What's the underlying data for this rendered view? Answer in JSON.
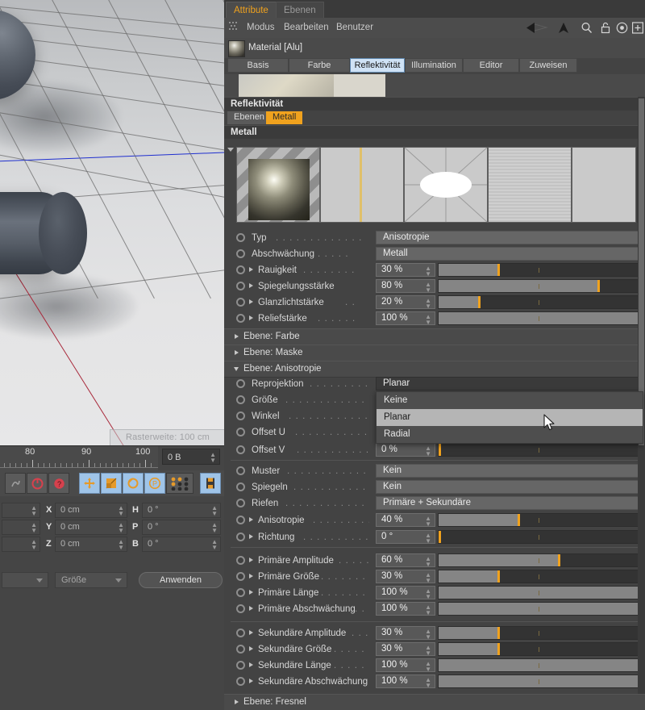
{
  "viewport": {
    "grid_tooltip": "Rasterweite: 100 cm"
  },
  "timeline": {
    "labels": [
      "80",
      "90",
      "100"
    ],
    "memory_value": "0 B"
  },
  "toolbar": {
    "buttons": [
      {
        "name": "undo-tool-icon",
        "label": ""
      },
      {
        "name": "record-position-icon",
        "label": ""
      },
      {
        "name": "autokeying-help-icon",
        "label": ""
      },
      {
        "name": "move-tool-icon",
        "label": ""
      },
      {
        "name": "scale-tool-icon",
        "label": ""
      },
      {
        "name": "rotate-tool-icon",
        "label": ""
      },
      {
        "name": "parameter-tool-icon",
        "label": ""
      },
      {
        "name": "point-level-animation-icon",
        "label": ""
      },
      {
        "name": "keyframe-selection-icon",
        "label": ""
      }
    ]
  },
  "coords": {
    "rows": [
      {
        "axis": "X",
        "pos": "0 cm",
        "rot_axis": "H",
        "rot": "0 °"
      },
      {
        "axis": "Y",
        "pos": "0 cm",
        "rot_axis": "P",
        "rot": "0 °"
      },
      {
        "axis": "Z",
        "pos": "0 cm",
        "rot_axis": "B",
        "rot": "0 °"
      }
    ],
    "mode_left": "",
    "mode_right": "Größe",
    "apply_label": "Anwenden"
  },
  "attribute_manager": {
    "tabs": [
      {
        "label": "Attribute",
        "active": true
      },
      {
        "label": "Ebenen",
        "active": false
      }
    ],
    "menu": [
      "Modus",
      "Bearbeiten",
      "Benutzer"
    ],
    "header_icons": [
      "back-arrow-icon",
      "up-arrow-icon",
      "search-icon",
      "lock-icon",
      "target-icon",
      "plus-icon"
    ],
    "object_title": "Material [Alu]",
    "subtabs": [
      {
        "label": "Basis",
        "selected": false
      },
      {
        "label": "Farbe",
        "selected": false
      },
      {
        "label": "Reflektivität",
        "selected": true
      },
      {
        "label": "Illumination",
        "selected": false
      },
      {
        "label": "Editor",
        "selected": false
      },
      {
        "label": "Zuweisen",
        "selected": false
      }
    ]
  },
  "reflectivity": {
    "section_title": "Reflektivität",
    "layer_tabs": [
      {
        "label": "Ebenen",
        "active": false
      },
      {
        "label": "Metall",
        "active": true
      }
    ],
    "layer_name_header": "Metall"
  },
  "params_top": [
    {
      "label": "Typ",
      "dots": ". . . . . . . . . . . . .",
      "type": "combo",
      "value": "Anisotropie",
      "expandable": false
    },
    {
      "label": "Abschwächung",
      "dots": ". . . . .",
      "type": "combo",
      "value": "Metall",
      "expandable": false
    },
    {
      "label": "Rauigkeit",
      "dots": ". . . . . . . .",
      "type": "slider",
      "value": "30 %",
      "pct": 30,
      "expandable": true
    },
    {
      "label": "Spiegelungsstärke",
      "dots": "",
      "type": "slider",
      "value": "80 %",
      "pct": 80,
      "expandable": true
    },
    {
      "label": "Glanzlichtstärke",
      "dots": ". .",
      "type": "slider",
      "value": "20 %",
      "pct": 20,
      "expandable": true
    },
    {
      "label": "Reliefstärke",
      "dots": ". . . . . .",
      "type": "slider",
      "value": "100 %",
      "pct": 100,
      "expandable": true
    }
  ],
  "groups": [
    {
      "label": "Ebene: Farbe",
      "open": false
    },
    {
      "label": "Ebene: Maske",
      "open": false
    },
    {
      "label": "Ebene: Anisotropie",
      "open": true
    }
  ],
  "params_aniso": [
    {
      "label": "Reprojektion",
      "dots": ". . . . . . . . . . . . .",
      "type": "combo",
      "value": "Planar",
      "expandable": false
    },
    {
      "label": "Größe",
      "dots": ". . . . . . . . . . . . . . . . .",
      "type": "hidden",
      "value": "",
      "expandable": false
    },
    {
      "label": "Winkel",
      "dots": ". . . . . . . . . . . . . . . .",
      "type": "hidden",
      "value": "",
      "expandable": false
    },
    {
      "label": "Offset U",
      "dots": ". . . . . . . . . . . . . . .",
      "type": "hidden",
      "value": "",
      "expandable": false
    },
    {
      "label": "Offset V",
      "dots": ". . . . . . . . . . . . . .",
      "type": "slider",
      "value": "0 %",
      "pct": 0,
      "expandable": false
    }
  ],
  "params_pattern": [
    {
      "label": "Muster",
      "dots": ". . . . . . . . . . . . . . . .",
      "type": "combo",
      "value": "Kein",
      "expandable": false
    },
    {
      "label": "Spiegeln",
      "dots": ". . . . . . . . . . . . . . .",
      "type": "combo",
      "value": "Kein",
      "expandable": false
    },
    {
      "label": "Riefen",
      "dots": ". . . . . . . . . . . . . . . .",
      "type": "combo",
      "value": "Primäre + Sekundäre",
      "expandable": false
    },
    {
      "label": "Anisotropie",
      "dots": ". . . . . . . . . . .",
      "type": "slider",
      "value": "40 %",
      "pct": 40,
      "expandable": true
    },
    {
      "label": "Richtung",
      "dots": ". . . . . . . . . . . . .",
      "type": "slider",
      "value": "0 °",
      "pct": 0,
      "expandable": true
    }
  ],
  "params_primary": [
    {
      "label": "Primäre Amplitude",
      "dots": ". . . . . . .",
      "type": "slider",
      "value": "60 %",
      "pct": 60,
      "expandable": true
    },
    {
      "label": "Primäre Größe",
      "dots": ". . . . . . . . .",
      "type": "slider",
      "value": "30 %",
      "pct": 30,
      "expandable": true
    },
    {
      "label": "Primäre Länge",
      "dots": ". . . . . . . . .",
      "type": "slider",
      "value": "100 %",
      "pct": 100,
      "expandable": true
    },
    {
      "label": "Primäre Abschwächung",
      "dots": ". .",
      "type": "slider",
      "value": "100 %",
      "pct": 100,
      "expandable": true
    }
  ],
  "params_secondary": [
    {
      "label": "Sekundäre Amplitude",
      "dots": ". . . .",
      "type": "slider",
      "value": "30 %",
      "pct": 30,
      "expandable": true
    },
    {
      "label": "Sekundäre Größe",
      "dots": ". . . . . . .",
      "type": "slider",
      "value": "30 %",
      "pct": 30,
      "expandable": true
    },
    {
      "label": "Sekundäre Länge",
      "dots": ". . . . . . .",
      "type": "slider",
      "value": "100 %",
      "pct": 100,
      "expandable": true
    },
    {
      "label": "Sekundäre Abschwächung",
      "dots": "",
      "type": "slider",
      "value": "100 %",
      "pct": 100,
      "expandable": true
    }
  ],
  "group_fresnel": {
    "label": "Ebene: Fresnel",
    "open": false
  },
  "dropdown": {
    "open": true,
    "options": [
      {
        "label": "Keine",
        "highlighted": false
      },
      {
        "label": "Planar",
        "highlighted": true
      },
      {
        "label": "Radial",
        "highlighted": false
      }
    ]
  },
  "colors": {
    "accent": "#f0a21e",
    "selected_tab": "#cfe2f5",
    "panel_bg": "#434343",
    "slider_fill": "#858585",
    "slider_track": "#333333"
  }
}
